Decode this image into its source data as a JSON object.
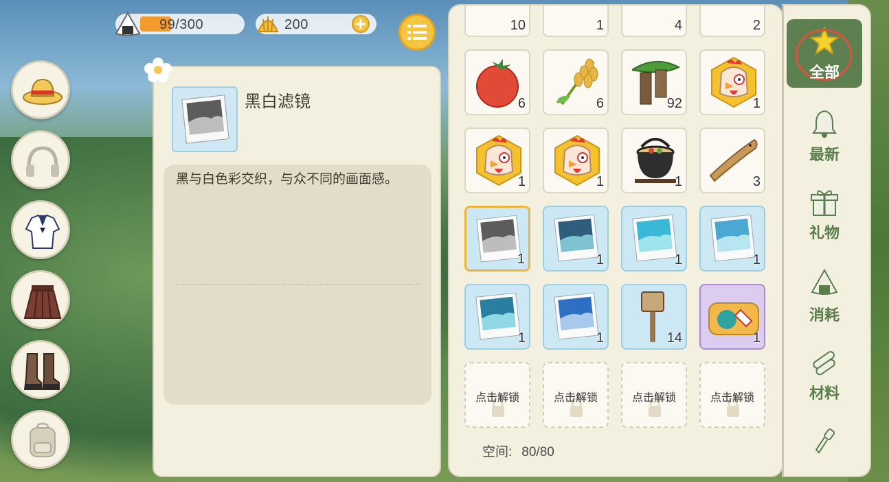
{
  "resources": {
    "stamina": {
      "value": "99/300",
      "fill_fraction": 0.33
    },
    "shells": {
      "value": "200"
    }
  },
  "side_menu": [
    "hat-icon",
    "headphones-icon",
    "shirt-icon",
    "skirt-icon",
    "boots-icon",
    "backpack-icon"
  ],
  "detail": {
    "title": "黑白滤镜",
    "description": "黑与白色彩交织，与众不同的画面感。"
  },
  "grid": {
    "top_partial_counts": [
      "10",
      "1",
      "4",
      "2"
    ],
    "items": [
      {
        "name": "tomato",
        "count": "6"
      },
      {
        "name": "wheat",
        "count": "6"
      },
      {
        "name": "wood-logs",
        "count": "92"
      },
      {
        "name": "chicken-badge",
        "count": "1"
      },
      {
        "name": "chicken-badge",
        "count": "1"
      },
      {
        "name": "chicken-badge",
        "count": "1"
      },
      {
        "name": "cooking-pot",
        "count": "1"
      },
      {
        "name": "dried-fish",
        "count": "3"
      },
      {
        "name": "filter-bw",
        "count": "1"
      },
      {
        "name": "filter-ocean-dark",
        "count": "1"
      },
      {
        "name": "filter-ocean-cyan",
        "count": "1"
      },
      {
        "name": "filter-ocean-light",
        "count": "1"
      },
      {
        "name": "filter-ocean-teal",
        "count": "1"
      },
      {
        "name": "filter-ocean-blue",
        "count": "1"
      },
      {
        "name": "wooden-sign",
        "count": "14"
      },
      {
        "name": "sticker-pack",
        "count": "1"
      }
    ],
    "locked_label": "点击解锁",
    "space_label": "空间:",
    "space_value": "80/80"
  },
  "tabs": [
    {
      "label": "全部",
      "icon": "star-icon"
    },
    {
      "label": "最新",
      "icon": "bell-icon"
    },
    {
      "label": "礼物",
      "icon": "gift-icon"
    },
    {
      "label": "消耗",
      "icon": "riceball-icon"
    },
    {
      "label": "材料",
      "icon": "material-icon"
    },
    {
      "icon": "shovel-icon"
    }
  ],
  "colors": {
    "panel": "#f4f0e0",
    "active_tab": "#5e7f4f",
    "tab_text": "#5a7d4c",
    "selected_border": "#f1b43a"
  }
}
